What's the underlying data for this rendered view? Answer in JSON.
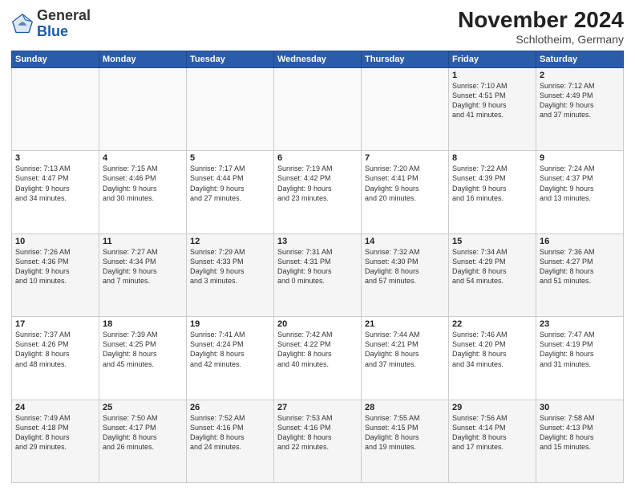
{
  "header": {
    "logo_general": "General",
    "logo_blue": "Blue",
    "month_year": "November 2024",
    "location": "Schlotheim, Germany"
  },
  "weekdays": [
    "Sunday",
    "Monday",
    "Tuesday",
    "Wednesday",
    "Thursday",
    "Friday",
    "Saturday"
  ],
  "weeks": [
    [
      {
        "day": "",
        "info": ""
      },
      {
        "day": "",
        "info": ""
      },
      {
        "day": "",
        "info": ""
      },
      {
        "day": "",
        "info": ""
      },
      {
        "day": "",
        "info": ""
      },
      {
        "day": "1",
        "info": "Sunrise: 7:10 AM\nSunset: 4:51 PM\nDaylight: 9 hours\nand 41 minutes."
      },
      {
        "day": "2",
        "info": "Sunrise: 7:12 AM\nSunset: 4:49 PM\nDaylight: 9 hours\nand 37 minutes."
      }
    ],
    [
      {
        "day": "3",
        "info": "Sunrise: 7:13 AM\nSunset: 4:47 PM\nDaylight: 9 hours\nand 34 minutes."
      },
      {
        "day": "4",
        "info": "Sunrise: 7:15 AM\nSunset: 4:46 PM\nDaylight: 9 hours\nand 30 minutes."
      },
      {
        "day": "5",
        "info": "Sunrise: 7:17 AM\nSunset: 4:44 PM\nDaylight: 9 hours\nand 27 minutes."
      },
      {
        "day": "6",
        "info": "Sunrise: 7:19 AM\nSunset: 4:42 PM\nDaylight: 9 hours\nand 23 minutes."
      },
      {
        "day": "7",
        "info": "Sunrise: 7:20 AM\nSunset: 4:41 PM\nDaylight: 9 hours\nand 20 minutes."
      },
      {
        "day": "8",
        "info": "Sunrise: 7:22 AM\nSunset: 4:39 PM\nDaylight: 9 hours\nand 16 minutes."
      },
      {
        "day": "9",
        "info": "Sunrise: 7:24 AM\nSunset: 4:37 PM\nDaylight: 9 hours\nand 13 minutes."
      }
    ],
    [
      {
        "day": "10",
        "info": "Sunrise: 7:26 AM\nSunset: 4:36 PM\nDaylight: 9 hours\nand 10 minutes."
      },
      {
        "day": "11",
        "info": "Sunrise: 7:27 AM\nSunset: 4:34 PM\nDaylight: 9 hours\nand 7 minutes."
      },
      {
        "day": "12",
        "info": "Sunrise: 7:29 AM\nSunset: 4:33 PM\nDaylight: 9 hours\nand 3 minutes."
      },
      {
        "day": "13",
        "info": "Sunrise: 7:31 AM\nSunset: 4:31 PM\nDaylight: 9 hours\nand 0 minutes."
      },
      {
        "day": "14",
        "info": "Sunrise: 7:32 AM\nSunset: 4:30 PM\nDaylight: 8 hours\nand 57 minutes."
      },
      {
        "day": "15",
        "info": "Sunrise: 7:34 AM\nSunset: 4:29 PM\nDaylight: 8 hours\nand 54 minutes."
      },
      {
        "day": "16",
        "info": "Sunrise: 7:36 AM\nSunset: 4:27 PM\nDaylight: 8 hours\nand 51 minutes."
      }
    ],
    [
      {
        "day": "17",
        "info": "Sunrise: 7:37 AM\nSunset: 4:26 PM\nDaylight: 8 hours\nand 48 minutes."
      },
      {
        "day": "18",
        "info": "Sunrise: 7:39 AM\nSunset: 4:25 PM\nDaylight: 8 hours\nand 45 minutes."
      },
      {
        "day": "19",
        "info": "Sunrise: 7:41 AM\nSunset: 4:24 PM\nDaylight: 8 hours\nand 42 minutes."
      },
      {
        "day": "20",
        "info": "Sunrise: 7:42 AM\nSunset: 4:22 PM\nDaylight: 8 hours\nand 40 minutes."
      },
      {
        "day": "21",
        "info": "Sunrise: 7:44 AM\nSunset: 4:21 PM\nDaylight: 8 hours\nand 37 minutes."
      },
      {
        "day": "22",
        "info": "Sunrise: 7:46 AM\nSunset: 4:20 PM\nDaylight: 8 hours\nand 34 minutes."
      },
      {
        "day": "23",
        "info": "Sunrise: 7:47 AM\nSunset: 4:19 PM\nDaylight: 8 hours\nand 31 minutes."
      }
    ],
    [
      {
        "day": "24",
        "info": "Sunrise: 7:49 AM\nSunset: 4:18 PM\nDaylight: 8 hours\nand 29 minutes."
      },
      {
        "day": "25",
        "info": "Sunrise: 7:50 AM\nSunset: 4:17 PM\nDaylight: 8 hours\nand 26 minutes."
      },
      {
        "day": "26",
        "info": "Sunrise: 7:52 AM\nSunset: 4:16 PM\nDaylight: 8 hours\nand 24 minutes."
      },
      {
        "day": "27",
        "info": "Sunrise: 7:53 AM\nSunset: 4:16 PM\nDaylight: 8 hours\nand 22 minutes."
      },
      {
        "day": "28",
        "info": "Sunrise: 7:55 AM\nSunset: 4:15 PM\nDaylight: 8 hours\nand 19 minutes."
      },
      {
        "day": "29",
        "info": "Sunrise: 7:56 AM\nSunset: 4:14 PM\nDaylight: 8 hours\nand 17 minutes."
      },
      {
        "day": "30",
        "info": "Sunrise: 7:58 AM\nSunset: 4:13 PM\nDaylight: 8 hours\nand 15 minutes."
      }
    ]
  ]
}
